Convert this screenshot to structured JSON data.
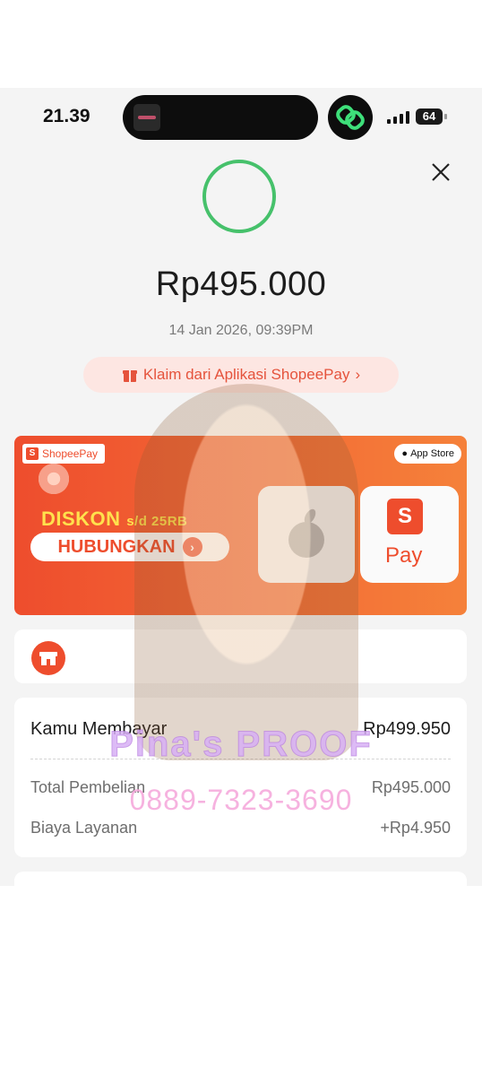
{
  "status_bar": {
    "time": "21.39",
    "battery": "64",
    "signal_icon": "signal-bars-icon",
    "link_icon": "linked-rings-icon"
  },
  "close_icon": "close-icon",
  "success_icon": "success-ring-icon",
  "amount": "Rp495.000",
  "datetime": "14 Jan 2026, 09:39PM",
  "claim": {
    "label": "Klaim dari Aplikasi ShopeePay",
    "icon": "gift-icon"
  },
  "banner": {
    "brand": "ShopeePay",
    "store_badge": "App Store",
    "promo_main": "DISKON",
    "promo_suffix": "s/d 25RB",
    "button_label": "HUBUNGKAN",
    "pay_word": "Pay",
    "colors": {
      "primary": "#ee4d2d",
      "promo_text": "#ffe14d"
    }
  },
  "merchant": {
    "icon": "store-icon"
  },
  "payment": {
    "title": "Kamu Membayar",
    "total": "Rp499.950",
    "rows": [
      {
        "label": "Total Pembelian",
        "value": "Rp495.000"
      },
      {
        "label": "Biaya Layanan",
        "value": "+Rp4.950"
      }
    ]
  },
  "watermark": {
    "title": "Pina's PROOF",
    "phone": "0889-7323-3690"
  },
  "colors": {
    "success": "#46c16b",
    "accent": "#ee4d2d",
    "claim_bg": "#fde6e2"
  }
}
